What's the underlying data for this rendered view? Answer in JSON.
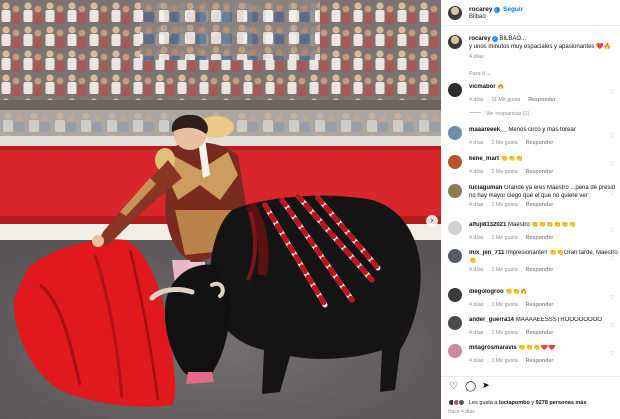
{
  "photo": {
    "alt": "bullfighting photograph",
    "next_icon": "chevron-right-icon",
    "next_glyph": "›"
  },
  "header": {
    "username": "rocarey",
    "follow_label": "Seguir",
    "separator": "•",
    "location": "Bilbao"
  },
  "caption": {
    "username": "rocarey",
    "text_line1": "BILBAO...",
    "text_line2": "y unos minutos muy espaciales y apasionantes ❤️🔥",
    "time": "4 días"
  },
  "sort_label": "Para ti ⌄",
  "comments": [
    {
      "username": "vicmabor",
      "text": "🔥",
      "time": "4 días",
      "likes": "11 Me gusta",
      "reply": "Responder",
      "avatar_color": "#2b2b2b"
    },
    {
      "username": "maaareeek__",
      "text": "Menos circo y mas torear",
      "time": "4 días",
      "likes": "2 Me gusta",
      "reply": "Responder",
      "avatar_color": "#6f8fa8"
    },
    {
      "username": "kene_mart",
      "text": "👏👏👏",
      "time": "4 días",
      "likes": "2 Me gusta",
      "reply": "Responder",
      "avatar_color": "#b5562e"
    },
    {
      "username": "luciaguman",
      "text": "Grande ya eres Maestro ...pena de presid",
      "text2": "no hay mayor ciego que el que no quiere ver",
      "time": "4 días",
      "likes": "1 Me gusta",
      "reply": "Responder",
      "avatar_color": "#8a7d52"
    },
    {
      "username": "alfuji8132021",
      "text": "Maestro 👏👏👏👏👏👏",
      "time": "4 días",
      "likes": "1 Me gusta",
      "reply": "Responder",
      "avatar_color": "#d0d0d0"
    },
    {
      "username": "mix_jen_711",
      "text": "Impresionante!! 👏👏Gran tarde, Maestro",
      "text2": "👏",
      "time": "4 días",
      "likes": "1 Me gusta",
      "reply": "Responder",
      "avatar_color": "#5a5a6a"
    },
    {
      "username": "diegologroo",
      "text": "👏👏🔥",
      "time": "4 días",
      "likes": "1 Me gusta",
      "reply": "Responder",
      "avatar_color": "#3a3a3a"
    },
    {
      "username": "ander_guerra14",
      "text": "MAAAAEESSSTROOOOOOOO",
      "time": "4 días",
      "likes": "1 Me gusta",
      "reply": "Responder",
      "avatar_color": "#4b4b4b"
    },
    {
      "username": "milagrosmaravis",
      "text": "👏👏👏❤️❤️",
      "time": "4 días",
      "likes": "1 Me gusta",
      "reply": "Responder",
      "avatar_color": "#c98a9a"
    }
  ],
  "view_replies": "Ver respuestas (1)",
  "actions": {
    "like_icon": "heart-icon",
    "like_glyph": "♡",
    "comment_icon": "comment-icon",
    "comment_glyph": "◯",
    "share_icon": "send-icon",
    "share_glyph": "➤",
    "likes_prefix": "Les gusta a",
    "likes_user": "luciapombo",
    "likes_joiner": "y",
    "likes_count": "9278 personas más",
    "ago": "Hace 4 días"
  }
}
